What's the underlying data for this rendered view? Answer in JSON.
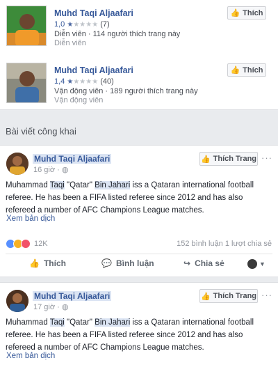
{
  "pages": [
    {
      "name": "Muhd Taqi Aljaafari",
      "rating": "1,0",
      "stars_filled": 1,
      "stars_total": 5,
      "rating_count": "(7)",
      "meta": "Diễn viên · 114 người thích trang này",
      "category": "Diễn viên",
      "like_label": "Thích"
    },
    {
      "name": "Muhd Taqi Aljaafari",
      "rating": "1,4",
      "stars_filled": 1,
      "stars_total": 5,
      "rating_count": "(40)",
      "meta": "Vận động viên · 189 người thích trang này",
      "category": "Vận động viên",
      "like_label": "Thích"
    }
  ],
  "section_title": "Bài viết công khai",
  "posts": [
    {
      "author": "Muhd Taqi Aljaafari",
      "time": "16 giờ · ",
      "follow_label": "Thích Trang",
      "text_parts": [
        "Muhammad ",
        "Taqi",
        " \"Qatar\" ",
        "Bin Jahari",
        " iss a Qataran international football referee. He has been a FIFA listed referee since 2012 and has also refereed a number of AFC Champions League matches."
      ],
      "translate": "Xem bản dịch",
      "reaction_count": "12K",
      "stats": "152 bình luận  1 lượt chia sẻ",
      "actions": [
        "Thích",
        "Bình luận",
        "Chia sẻ"
      ]
    },
    {
      "author": "Muhd Taqi Aljaafari",
      "time": "17 giờ · ",
      "follow_label": "Thích Trang",
      "text_parts": [
        "Muhammad ",
        "Taqi",
        " \"Qatar\" ",
        "Bin Jahari",
        " iss a Qataran international football referee. He has been a FIFA listed referee since 2012 and has also refereed a number of AFC Champions League matches."
      ],
      "translate": "Xem bản dịch"
    }
  ],
  "colors": {
    "link": "#365899",
    "highlight": "#dbe4f3",
    "background": "#e9ebee"
  }
}
